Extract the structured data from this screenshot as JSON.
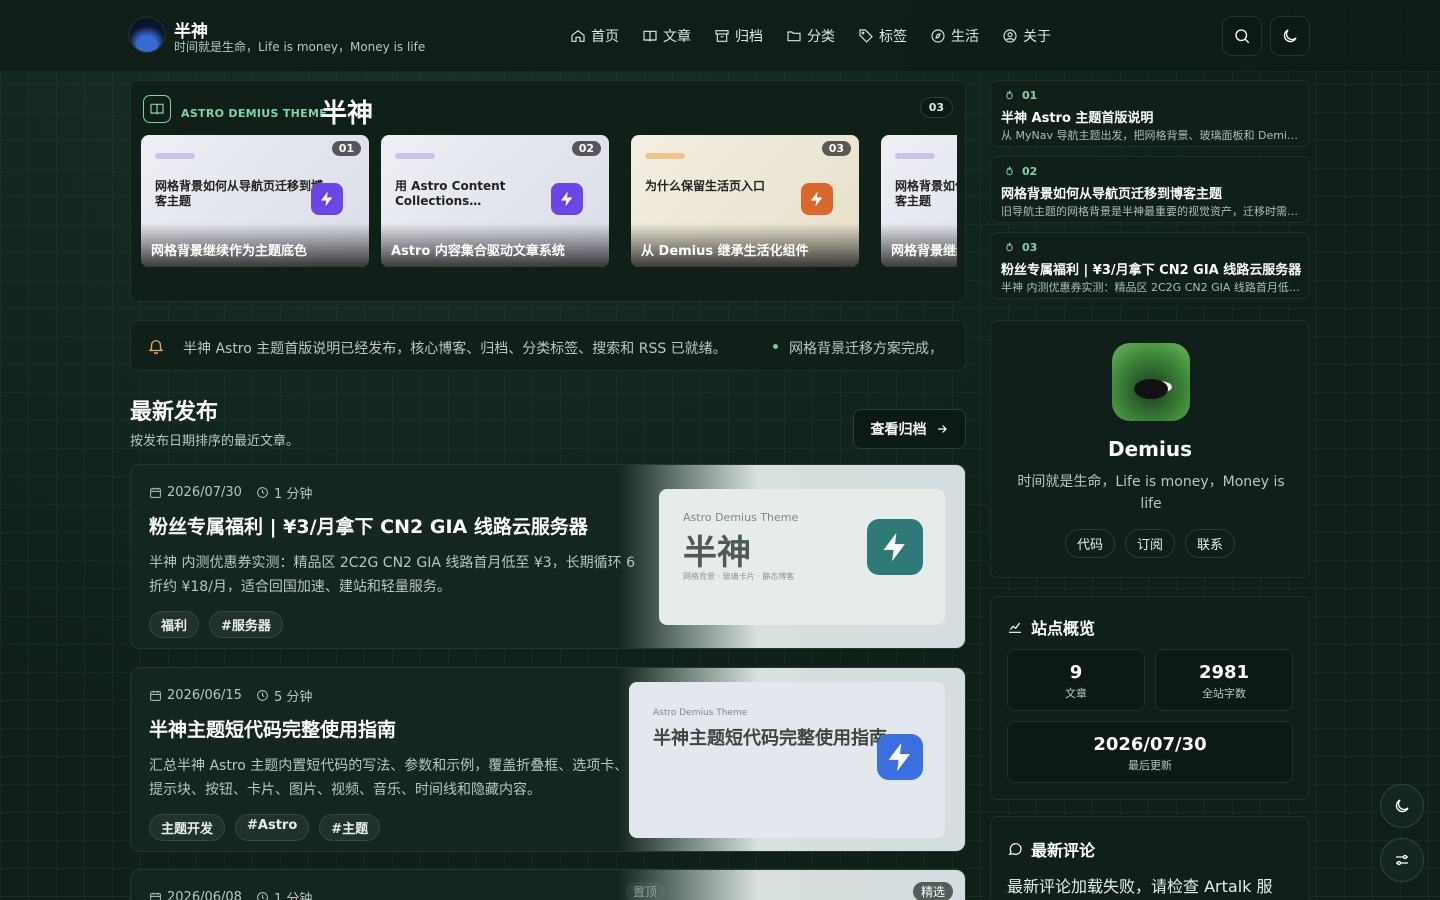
{
  "header": {
    "title": "半神",
    "subtitle": "时间就是生命，Life is money，Money is life",
    "nav": [
      {
        "label": "首页",
        "icon": "home-icon"
      },
      {
        "label": "文章",
        "icon": "book-icon"
      },
      {
        "label": "归档",
        "icon": "archive-icon"
      },
      {
        "label": "分类",
        "icon": "folder-icon"
      },
      {
        "label": "标签",
        "icon": "tag-icon"
      },
      {
        "label": "生活",
        "icon": "compass-icon"
      },
      {
        "label": "关于",
        "icon": "user-icon"
      }
    ]
  },
  "featured": {
    "label": "ASTRO DEMIUS THEME",
    "title": "半神",
    "count": "03",
    "slides": [
      {
        "num": "01",
        "title": "网格背景如何从导航页迁移到博客主题",
        "caption": "网格背景继续作为主题底色"
      },
      {
        "num": "02",
        "title": "用 Astro Content Collections…",
        "caption": "Astro 内容集合驱动文章系统"
      },
      {
        "num": "03",
        "title": "为什么保留生活页入口",
        "caption": "从 Demius 继承生活化组件"
      }
    ],
    "partial_slide": {
      "title": "网格背景如何从导航页迁移到博客主题",
      "caption": "网格背景继续作为主题底色"
    }
  },
  "notice": {
    "message": "半神 Astro 主题首版说明已经发布，核心博客、归档、分类标签、搜索和 RSS 已就绪。",
    "message2": "网格背景迁移方案完成，"
  },
  "latest": {
    "title": "最新发布",
    "subtitle": "按发布日期排序的最近文章。",
    "archive_button": "查看归档",
    "posts": [
      {
        "date": "2026/07/30",
        "read": "1 分钟",
        "title": "粉丝专属福利 | ¥3/月拿下 CN2 GIA 线路云服务器",
        "desc": "半神 内测优惠券实测：精品区 2C2G CN2 GIA 线路首月低至 ¥3，长期循环 6 折约 ¥18/月，适合回国加速、建站和轻量服务。",
        "tags": [
          "福利",
          "#服务器"
        ],
        "thumb": {
          "small": "Astro Demius Theme",
          "big": "半神",
          "foot": "网格背景 · 玻璃卡片 · 静态博客"
        }
      },
      {
        "date": "2026/06/15",
        "read": "5 分钟",
        "title": "半神主题短代码完整使用指南",
        "desc": "汇总半神 Astro 主题内置短代码的写法、参数和示例，覆盖折叠框、选项卡、提示块、按钮、卡片、图片、视频、音乐、时间线和隐藏内容。",
        "tags": [
          "主题开发",
          "#Astro",
          "#主题"
        ],
        "thumb": {
          "small": "Astro Demius Theme",
          "big": "半神主题短代码完整使用指南",
          "foot": ""
        }
      },
      {
        "date": "2026/06/08",
        "read": "1 分钟",
        "badge_top": "置顶",
        "badge_pick": "精选"
      }
    ]
  },
  "hot": [
    {
      "rank": "01",
      "title": "半神 Astro 主题首版说明",
      "desc": "从 MyNav 导航主题出发，把网格背景、玻璃面板和 Demius 组件带入 Astro 主题"
    },
    {
      "rank": "02",
      "title": "网格背景如何从导航页迁移到博客主题",
      "desc": "旧导航主题的网格背景是半神最重要的视觉资产，迁移时需要保留"
    },
    {
      "rank": "03",
      "title": "粉丝专属福利 | ¥3/月拿下 CN2 GIA 线路云服务器",
      "desc": "半神 内测优惠券实测：精品区 2C2G CN2 GIA 线路首月低至 ¥3"
    }
  ],
  "profile": {
    "name": "Demius",
    "bio": "时间就是生命，Life is money，Money is life",
    "links": [
      "代码",
      "订阅",
      "联系"
    ]
  },
  "stats": {
    "title": "站点概览",
    "posts_value": "9",
    "posts_label": "文章",
    "words_value": "2981",
    "words_label": "全站字数",
    "updated_value": "2026/07/30",
    "updated_label": "最后更新"
  },
  "comments": {
    "title": "最新评论",
    "error": "最新评论加载失败，请检查 Artalk 服"
  },
  "colors": {
    "accent": "#7fd3aa",
    "background": "#102019",
    "bolt_purple": "#6b46e5",
    "bolt_orange": "#d8682c"
  }
}
